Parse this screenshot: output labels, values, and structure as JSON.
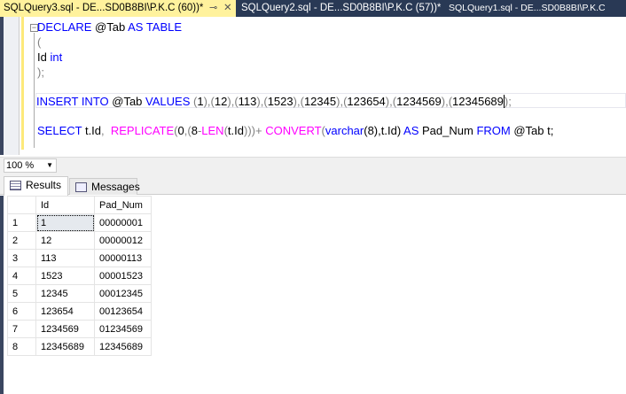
{
  "tabs": [
    {
      "label": "SQLQuery3.sql - DE...SD0B8BI\\P.K.C (60))*",
      "pin": "⊸",
      "close": "✕"
    },
    {
      "label": "SQLQuery2.sql - DE...SD0B8BI\\P.K.C (57))*"
    },
    {
      "label": "SQLQuery1.sql - DE...SD0B8BI\\P.K.C"
    }
  ],
  "code": {
    "l1": [
      "DECLARE",
      " @Tab ",
      "AS TABLE"
    ],
    "l2": "(",
    "l3": [
      "Id ",
      "int"
    ],
    "l4": [
      ")",
      ";"
    ],
    "l6": [
      "INSERT INTO",
      " @Tab ",
      "VALUES ",
      "(",
      "1",
      ")",
      ",",
      "(",
      "12",
      ")",
      ",",
      "(",
      "113",
      ")",
      ",",
      "(",
      "1523",
      ")",
      ",",
      "(",
      "12345",
      ")",
      ",",
      "(",
      "123654",
      ")",
      ",",
      "(",
      "1234569",
      ")",
      ",",
      "(",
      "12345689",
      ")",
      ";"
    ],
    "l8": [
      "SELECT",
      " t.Id",
      ",  ",
      "REPLICATE",
      "(",
      "0",
      ",",
      "(",
      "8",
      "-",
      "LEN",
      "(",
      "t.Id",
      ")))",
      "+ ",
      "CONVERT",
      "(",
      "varchar",
      "(8),t.Id) ",
      "AS",
      " Pad_Num ",
      "FROM",
      " @Tab t;"
    ]
  },
  "zoom": "100 %",
  "results_tabs": {
    "results": "Results",
    "messages": "Messages"
  },
  "grid": {
    "columns": [
      "Id",
      "Pad_Num"
    ],
    "rows": [
      [
        "1",
        "1",
        "00000001"
      ],
      [
        "2",
        "12",
        "00000012"
      ],
      [
        "3",
        "113",
        "00000113"
      ],
      [
        "4",
        "1523",
        "00001523"
      ],
      [
        "5",
        "12345",
        "00012345"
      ],
      [
        "6",
        "123654",
        "00123654"
      ],
      [
        "7",
        "1234569",
        "01234569"
      ],
      [
        "8",
        "12345689",
        "12345689"
      ]
    ]
  }
}
